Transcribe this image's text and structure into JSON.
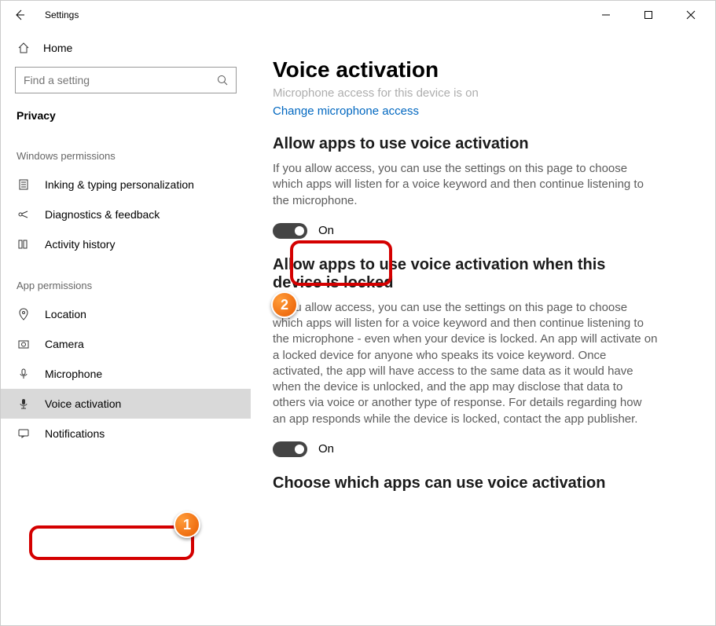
{
  "window": {
    "app_title": "Settings"
  },
  "sidebar": {
    "home_label": "Home",
    "search_placeholder": "Find a setting",
    "category_label": "Privacy",
    "group_windows": "Windows permissions",
    "group_app": "App permissions",
    "items_win": [
      {
        "label": "Inking & typing personalization"
      },
      {
        "label": "Diagnostics & feedback"
      },
      {
        "label": "Activity history"
      }
    ],
    "items_app": [
      {
        "label": "Location"
      },
      {
        "label": "Camera"
      },
      {
        "label": "Microphone"
      },
      {
        "label": "Voice activation"
      },
      {
        "label": "Notifications"
      }
    ]
  },
  "main": {
    "page_title": "Voice activation",
    "cut_line": "Microphone access for this device is on",
    "mic_link": "Change microphone access",
    "section1_title": "Allow apps to use voice activation",
    "section1_desc": "If you allow access, you can use the settings on this page to choose which apps will listen for a voice keyword and then continue listening to the microphone.",
    "toggle1_label": "On",
    "section2_title": "Allow apps to use voice activation when this device is locked",
    "section2_desc": "If you allow access, you can use the settings on this page to choose which apps will listen for a voice keyword and then continue listening to the microphone - even when your device is locked. An app will activate on a locked device for anyone who speaks its voice keyword. Once activated, the app will have access to the same data as it would have when the device is unlocked, and the app may disclose that data to others via voice or another type of response. For details regarding how an app responds while the device is locked, contact the app publisher.",
    "toggle2_label": "On",
    "section3_title": "Choose which apps can use voice activation"
  },
  "annotations": {
    "badge1": "1",
    "badge2": "2"
  }
}
